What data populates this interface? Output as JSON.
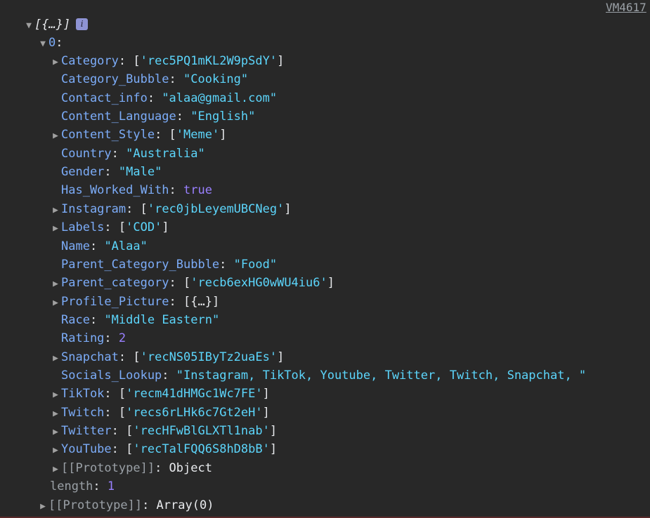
{
  "vm_link": "VM4617",
  "root": {
    "label": "[{…}]",
    "info_icon": "i"
  },
  "item0": {
    "label": "0"
  },
  "props": [
    {
      "key": "Category",
      "value": "'rec5PQ1mKL2W9pSdY'",
      "kind": "array",
      "expandable": true
    },
    {
      "key": "Category_Bubble",
      "value": "\"Cooking\"",
      "kind": "string",
      "expandable": false
    },
    {
      "key": "Contact_info",
      "value": "\"alaa@gmail.com\"",
      "kind": "string",
      "expandable": false
    },
    {
      "key": "Content_Language",
      "value": "\"English\"",
      "kind": "string",
      "expandable": false
    },
    {
      "key": "Content_Style",
      "value": "'Meme'",
      "kind": "array",
      "expandable": true
    },
    {
      "key": "Country",
      "value": "\"Australia\"",
      "kind": "string",
      "expandable": false
    },
    {
      "key": "Gender",
      "value": "\"Male\"",
      "kind": "string",
      "expandable": false
    },
    {
      "key": "Has_Worked_With",
      "value": "true",
      "kind": "bool",
      "expandable": false
    },
    {
      "key": "Instagram",
      "value": "'rec0jbLeyemUBCNeg'",
      "kind": "array",
      "expandable": true
    },
    {
      "key": "Labels",
      "value": "'COD'",
      "kind": "array",
      "expandable": true
    },
    {
      "key": "Name",
      "value": "\"Alaa\"",
      "kind": "string",
      "expandable": false
    },
    {
      "key": "Parent_Category_Bubble",
      "value": "\"Food\"",
      "kind": "string",
      "expandable": false
    },
    {
      "key": "Parent_category",
      "value": "'recb6exHG0wWU4iu6'",
      "kind": "array",
      "expandable": true
    },
    {
      "key": "Profile_Picture",
      "value": "{…}",
      "kind": "objarray",
      "expandable": true
    },
    {
      "key": "Race",
      "value": "\"Middle Eastern\"",
      "kind": "string",
      "expandable": false
    },
    {
      "key": "Rating",
      "value": "2",
      "kind": "number",
      "expandable": false
    },
    {
      "key": "Snapchat",
      "value": "'recNS05IByTz2uaEs'",
      "kind": "array",
      "expandable": true
    },
    {
      "key": "Socials_Lookup",
      "value": "\"Instagram, TikTok, Youtube, Twitter, Twitch, Snapchat, \"",
      "kind": "string",
      "expandable": false
    },
    {
      "key": "TikTok",
      "value": "'recm41dHMGc1Wc7FE'",
      "kind": "array",
      "expandable": true
    },
    {
      "key": "Twitch",
      "value": "'recs6rLHk6c7Gt2eH'",
      "kind": "array",
      "expandable": true
    },
    {
      "key": "Twitter",
      "value": "'recHFwBlGLXTl1nab'",
      "kind": "array",
      "expandable": true
    },
    {
      "key": "YouTube",
      "value": "'recTalFQQ6S8hD8bB'",
      "kind": "array",
      "expandable": true
    },
    {
      "key": "[[Prototype]]",
      "value": "Object",
      "kind": "proto",
      "expandable": true
    }
  ],
  "length_row": {
    "key": "length",
    "value": "1"
  },
  "array_proto": {
    "key": "[[Prototype]]",
    "value": "Array(0)"
  }
}
